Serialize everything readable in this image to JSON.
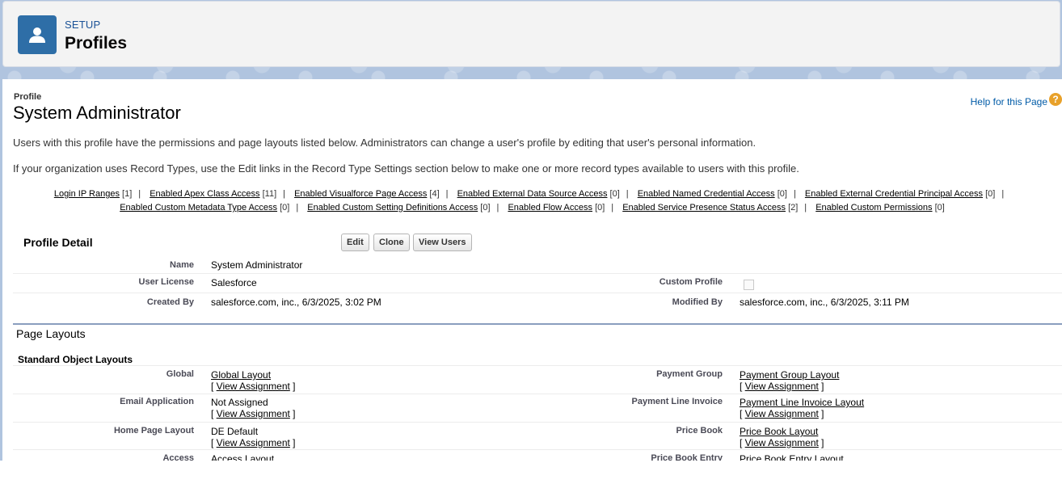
{
  "header": {
    "setup_label": "SETUP",
    "title": "Profiles"
  },
  "profile": {
    "small_label": "Profile",
    "title": "System Administrator",
    "help_link": "Help for this Page",
    "help_icon": "question-icon",
    "description_1": "Users with this profile have the permissions and page layouts listed below. Administrators can change a user's profile by editing that user's personal information.",
    "description_2": "If your organization uses Record Types, use the Edit links in the Record Type Settings section below to make one or more record types available to users with this profile."
  },
  "related_links": {
    "row1": [
      {
        "label": "Login IP Ranges",
        "count": "[1]"
      },
      {
        "label": "Enabled Apex Class Access",
        "count": "[11]"
      },
      {
        "label": "Enabled Visualforce Page Access",
        "count": "[4]"
      },
      {
        "label": "Enabled External Data Source Access",
        "count": "[0]"
      },
      {
        "label": "Enabled Named Credential Access",
        "count": "[0]"
      },
      {
        "label": "Enabled External Credential Principal Access",
        "count": "[0]"
      }
    ],
    "row2": [
      {
        "label": "Enabled Custom Metadata Type Access",
        "count": "[0]"
      },
      {
        "label": "Enabled Custom Setting Definitions Access",
        "count": "[0]"
      },
      {
        "label": "Enabled Flow Access",
        "count": "[0]"
      },
      {
        "label": "Enabled Service Presence Status Access",
        "count": "[2]"
      },
      {
        "label": "Enabled Custom Permissions",
        "count": "[0]"
      }
    ]
  },
  "profile_detail": {
    "title": "Profile Detail",
    "buttons": {
      "edit": "Edit",
      "clone": "Clone",
      "view_users": "View Users"
    },
    "name_label": "Name",
    "name_value": "System Administrator",
    "user_license_label": "User License",
    "user_license_value": "Salesforce",
    "custom_profile_label": "Custom Profile",
    "custom_profile_checked": false,
    "created_by_label": "Created By",
    "created_by_value": "salesforce.com, inc., 6/3/2025, 3:02 PM",
    "modified_by_label": "Modified By",
    "modified_by_value": "salesforce.com, inc., 6/3/2025, 3:11 PM"
  },
  "page_layouts": {
    "title": "Page Layouts",
    "subtitle": "Standard Object Layouts",
    "view_assignment": "View Assignment",
    "rows": [
      {
        "left_label": "Global",
        "left_value": "Global Layout",
        "left_is_link": true,
        "right_label": "Payment Group",
        "right_value": "Payment Group Layout"
      },
      {
        "left_label": "Email Application",
        "left_value": "Not Assigned",
        "left_is_link": false,
        "right_label": "Payment Line Invoice",
        "right_value": "Payment Line Invoice Layout"
      },
      {
        "left_label": "Home Page Layout",
        "left_value": "DE Default",
        "left_is_link": false,
        "right_label": "Price Book",
        "right_value": "Price Book Layout"
      },
      {
        "left_label": "Access",
        "left_value": "Access Layout",
        "left_is_link": true,
        "right_label": "Price Book Entry",
        "right_value": "Price Book Entry Layout"
      }
    ]
  },
  "colors": {
    "brand_blue": "#2e6ea7",
    "link_blue": "#015ba7",
    "help_orange": "#e8a12a"
  }
}
